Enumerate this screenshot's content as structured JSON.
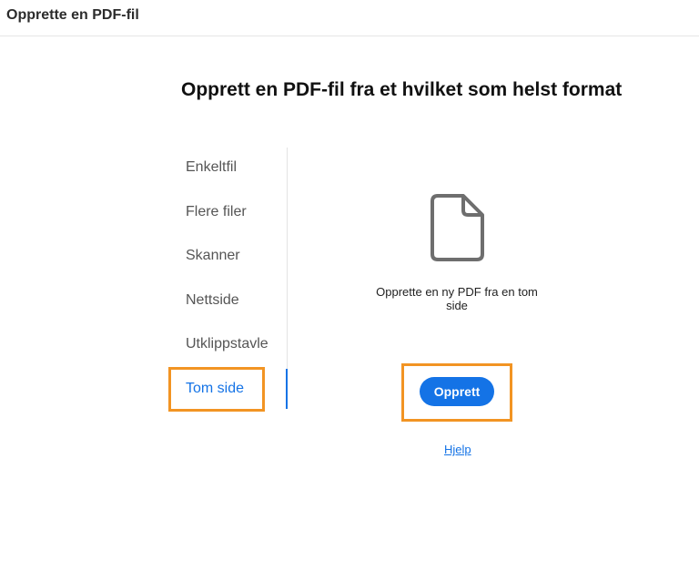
{
  "window": {
    "title": "Opprette en PDF-fil"
  },
  "main": {
    "heading": "Opprett en PDF-fil fra et hvilket som helst format",
    "nav": {
      "items": [
        {
          "label": "Enkeltfil"
        },
        {
          "label": "Flere filer"
        },
        {
          "label": "Skanner"
        },
        {
          "label": "Nettside"
        },
        {
          "label": "Utklippstavle"
        },
        {
          "label": "Tom side"
        }
      ],
      "selected": "Tom side"
    },
    "panel": {
      "icon": "blank-document-icon",
      "description": "Opprette en ny PDF fra en tom side",
      "create_button": "Opprett",
      "help_link": "Hjelp"
    }
  },
  "colors": {
    "accent": "#1473e6",
    "highlight": "#f29423"
  }
}
